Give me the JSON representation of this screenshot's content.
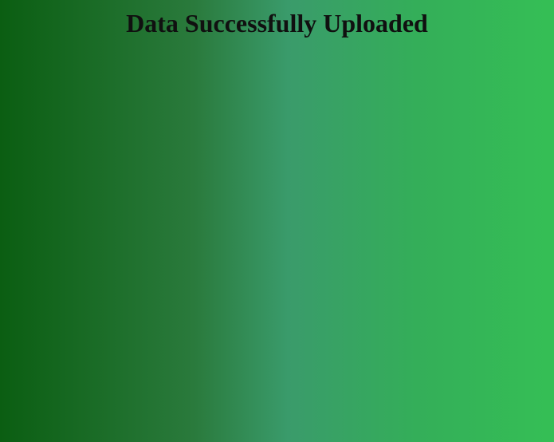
{
  "page": {
    "title": "Data Successfully Uploaded"
  },
  "colors": {
    "gradient_left": "#0b5e12",
    "gradient_mid": "#3a9b6b",
    "gradient_right": "#35bf55",
    "title_text": "#101010"
  }
}
